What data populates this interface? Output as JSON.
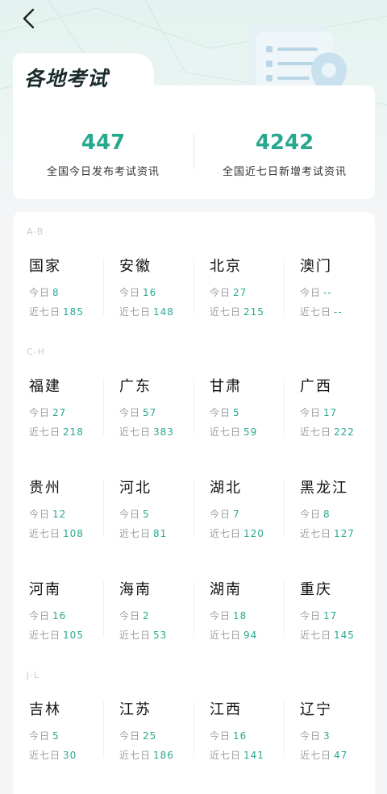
{
  "header": {
    "title": "各地考试",
    "back_icon": "chevron-left-icon",
    "illustration_icon": "document-location-icon"
  },
  "summary": {
    "today_count": "447",
    "today_label": "全国今日发布考试资讯",
    "week_count": "4242",
    "week_label": "全国近七日新增考试资讯"
  },
  "labels": {
    "today": "今日",
    "week": "近七日"
  },
  "groups": [
    {
      "label": "A-B",
      "regions": [
        {
          "name": "国家",
          "today": "8",
          "week": "185"
        },
        {
          "name": "安徽",
          "today": "16",
          "week": "148"
        },
        {
          "name": "北京",
          "today": "27",
          "week": "215"
        },
        {
          "name": "澳门",
          "today": "--",
          "week": "--"
        }
      ]
    },
    {
      "label": "C-H",
      "regions": [
        {
          "name": "福建",
          "today": "27",
          "week": "218"
        },
        {
          "name": "广东",
          "today": "57",
          "week": "383"
        },
        {
          "name": "甘肃",
          "today": "5",
          "week": "59"
        },
        {
          "name": "广西",
          "today": "17",
          "week": "222"
        },
        {
          "name": "贵州",
          "today": "12",
          "week": "108"
        },
        {
          "name": "河北",
          "today": "5",
          "week": "81"
        },
        {
          "name": "湖北",
          "today": "7",
          "week": "120"
        },
        {
          "name": "黑龙江",
          "today": "8",
          "week": "127"
        },
        {
          "name": "河南",
          "today": "16",
          "week": "105"
        },
        {
          "name": "海南",
          "today": "2",
          "week": "53"
        },
        {
          "name": "湖南",
          "today": "18",
          "week": "94"
        },
        {
          "name": "重庆",
          "today": "17",
          "week": "145"
        }
      ]
    },
    {
      "label": "J-L",
      "regions": [
        {
          "name": "吉林",
          "today": "5",
          "week": "30"
        },
        {
          "name": "江苏",
          "today": "25",
          "week": "186"
        },
        {
          "name": "江西",
          "today": "16",
          "week": "141"
        },
        {
          "name": "辽宁",
          "today": "3",
          "week": "47"
        }
      ]
    }
  ],
  "colors": {
    "accent": "#28a98f",
    "muted": "#9a9ea2",
    "background": "#f3f5f7"
  }
}
